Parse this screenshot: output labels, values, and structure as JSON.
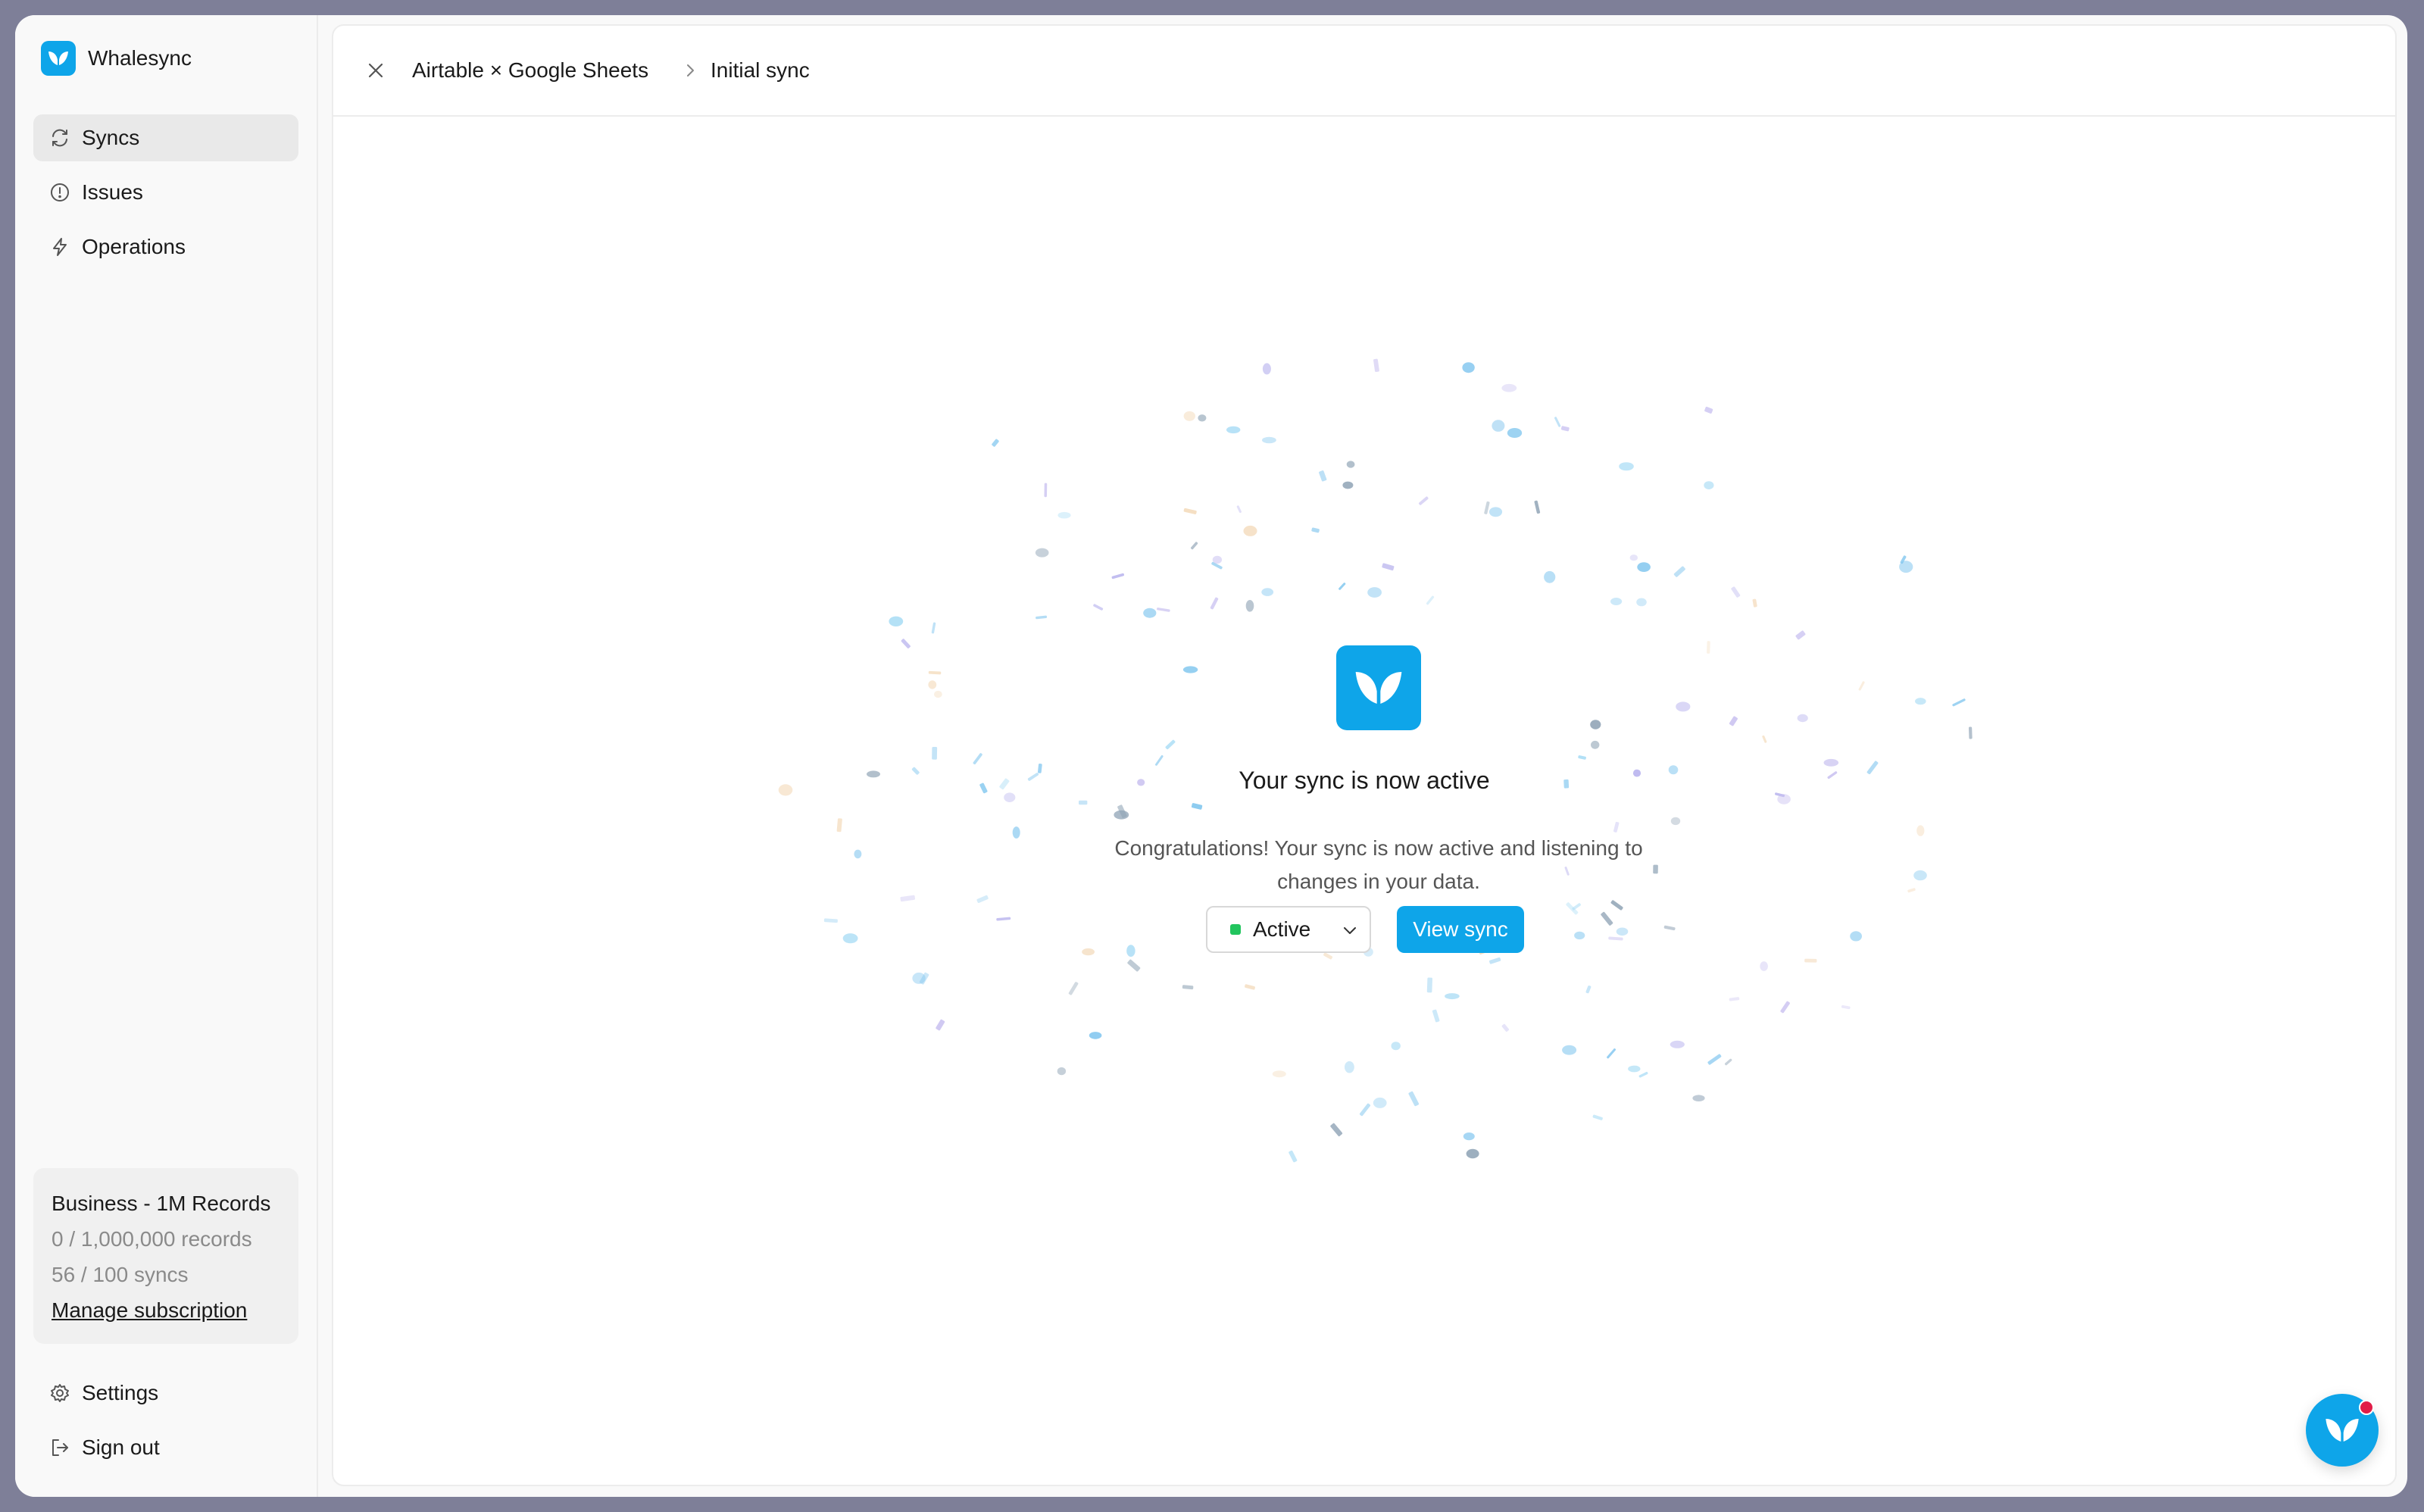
{
  "app": {
    "name": "Whalesync",
    "accent": "#0ea5e9"
  },
  "sidebar": {
    "items": [
      {
        "label": "Syncs",
        "icon": "refresh-icon",
        "active": true
      },
      {
        "label": "Issues",
        "icon": "alert-circle-icon",
        "active": false
      },
      {
        "label": "Operations",
        "icon": "lightning-icon",
        "active": false
      }
    ],
    "plan": {
      "title": "Business - 1M Records",
      "records": "0 / 1,000,000 records",
      "syncs": "56 / 100 syncs",
      "manage_label": "Manage subscription"
    },
    "bottom_items": [
      {
        "label": "Settings",
        "icon": "gear-icon"
      },
      {
        "label": "Sign out",
        "icon": "sign-out-icon"
      }
    ]
  },
  "header": {
    "close_icon": "close-icon",
    "breadcrumb": [
      "Airtable × Google Sheets",
      "Initial sync"
    ]
  },
  "main": {
    "title": "Your sync is now active",
    "message": "Congratulations! Your sync is now active and listening to changes in your data.",
    "status_select": {
      "value": "Active",
      "status_color": "#22c55e"
    },
    "view_button": "View sync"
  },
  "chat": {
    "icon": "whale-tail-icon",
    "notification_color": "#e11d48"
  }
}
